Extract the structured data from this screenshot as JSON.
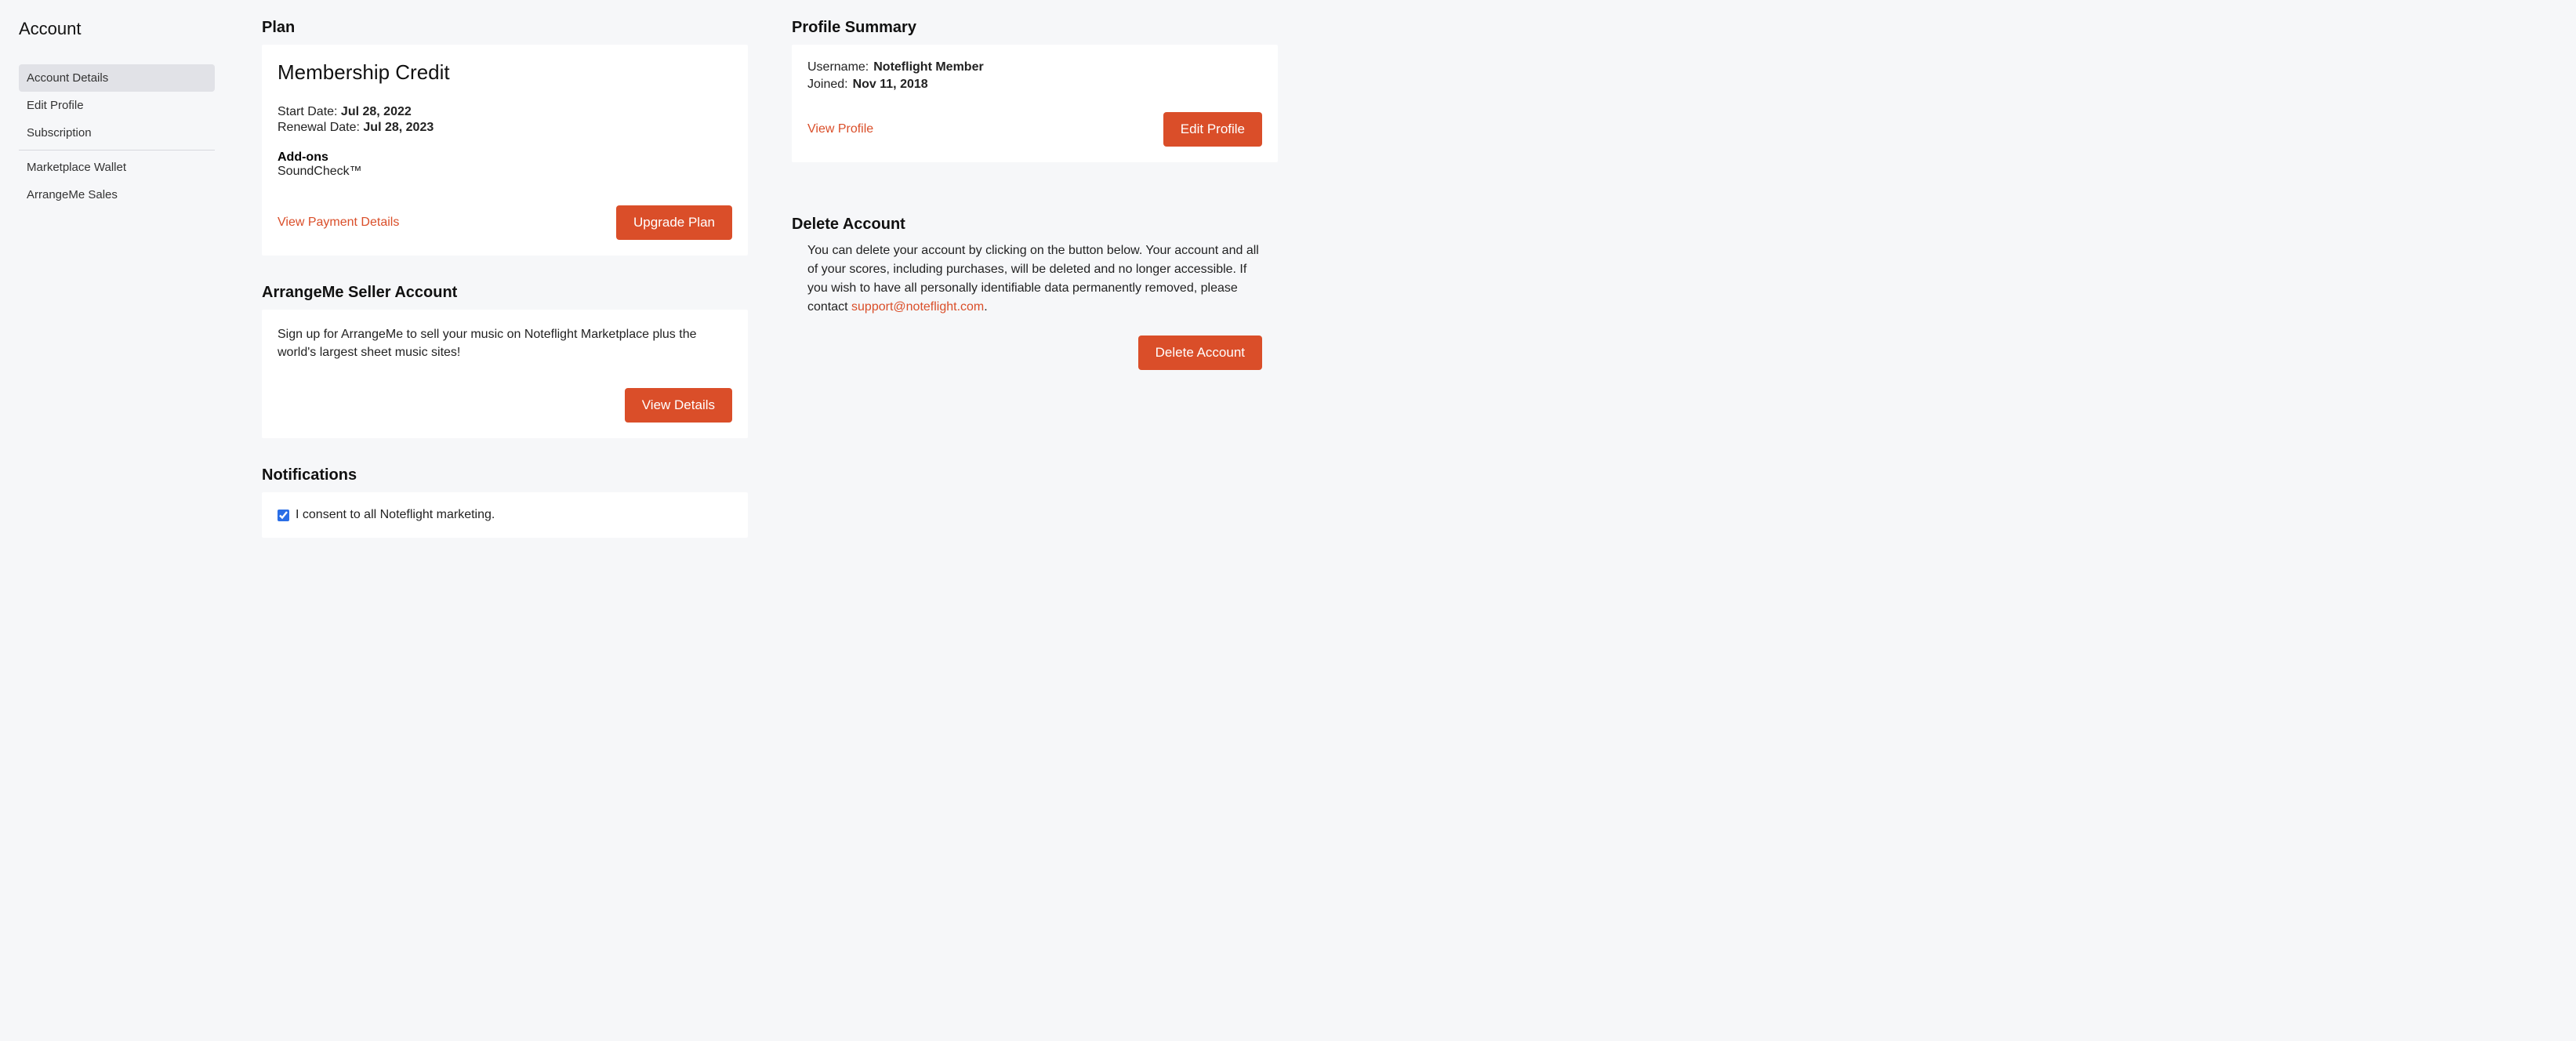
{
  "sidebar": {
    "title": "Account",
    "items": [
      {
        "label": "Account Details",
        "active": true
      },
      {
        "label": "Edit Profile",
        "active": false
      },
      {
        "label": "Subscription",
        "active": false
      },
      {
        "label": "Marketplace Wallet",
        "active": false
      },
      {
        "label": "ArrangeMe Sales",
        "active": false
      }
    ]
  },
  "plan": {
    "heading": "Plan",
    "name": "Membership Credit",
    "start_label": "Start Date: ",
    "start_value": "Jul 28, 2022",
    "renewal_label": "Renewal Date: ",
    "renewal_value": "Jul 28, 2023",
    "addons_label": "Add-ons",
    "addons_value": "SoundCheck™",
    "view_payment_link": "View Payment Details",
    "upgrade_button": "Upgrade Plan"
  },
  "arrangeme": {
    "heading": "ArrangeMe Seller Account",
    "desc": "Sign up for ArrangeMe to sell your music on Noteflight Marketplace plus the world's largest sheet music sites!",
    "view_details_button": "View Details"
  },
  "notifications": {
    "heading": "Notifications",
    "consent_label": "I consent to all Noteflight marketing.",
    "consent_checked": true
  },
  "profile": {
    "heading": "Profile Summary",
    "username_label": "Username:",
    "username_value": "Noteflight Member",
    "joined_label": "Joined:",
    "joined_value": "Nov 11, 2018",
    "view_profile_link": "View Profile",
    "edit_profile_button": "Edit Profile"
  },
  "delete": {
    "heading": "Delete Account",
    "text": "You can delete your account by clicking on the button below. Your account and all of your scores, including purchases, will be deleted and no longer accessible. If you wish to have all personally identifiable data permanently removed, please contact ",
    "support_link": "support@noteflight.com",
    "period": ".",
    "delete_button": "Delete Account"
  }
}
